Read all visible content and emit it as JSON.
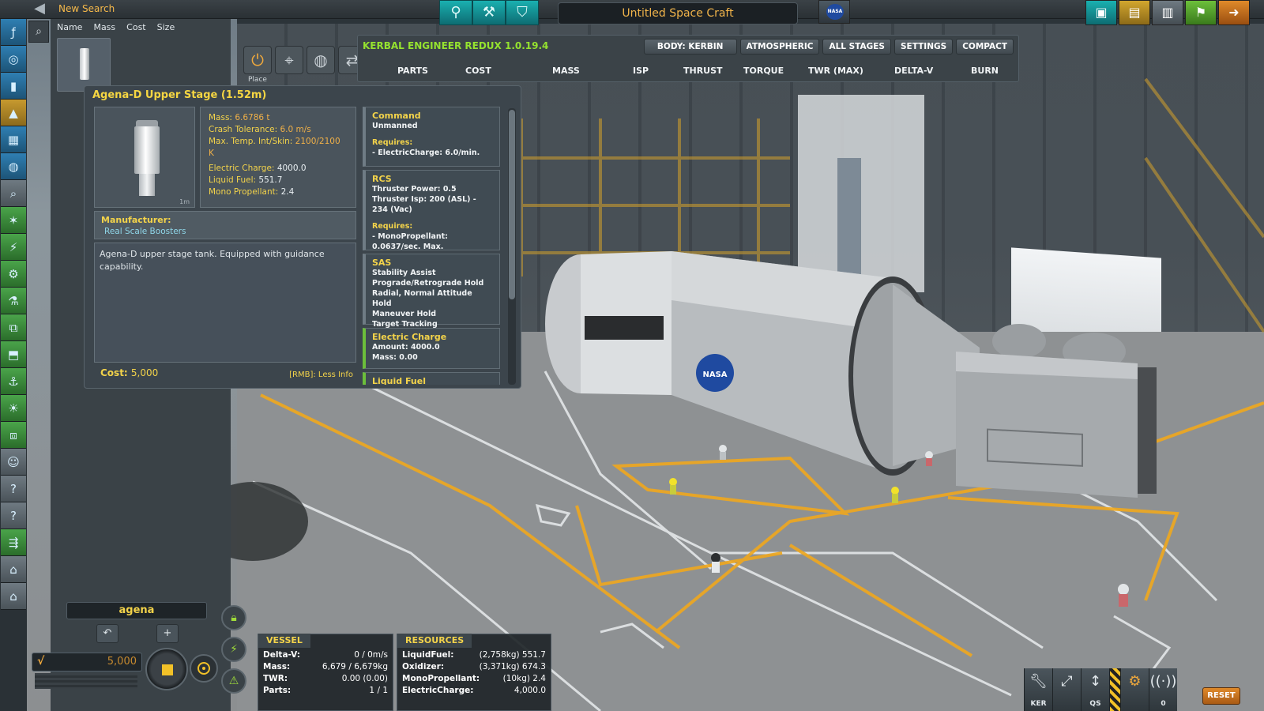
{
  "topbar": {
    "search_title": "New Search",
    "craft_name": "Untitled Space Craft"
  },
  "parts_list": {
    "sort_columns": [
      "Name",
      "Mass",
      "Cost",
      "Size"
    ],
    "search_value": "agena",
    "funds": "5,000"
  },
  "editor_tools": {
    "place_label": "Place"
  },
  "part_info": {
    "title": "Agena-D Upper Stage (1.52m)",
    "scale_label": "1m",
    "stats": {
      "mass_label": "Mass:",
      "mass_value": "6.6786 t",
      "crash_label": "Crash Tolerance:",
      "crash_value": "6.0 m/s",
      "temp_label": "Max. Temp. Int/Skin:",
      "temp_value": "2100/2100 K",
      "electric_label": "Electric Charge:",
      "electric_value": "4000.0",
      "liquid_label": "Liquid Fuel:",
      "liquid_value": "551.7",
      "mono_label": "Mono Propellant:",
      "mono_value": "2.4"
    },
    "manufacturer_label": "Manufacturer:",
    "manufacturer_name": "Real Scale Boosters",
    "description": "Agena-D upper stage tank. Equipped with guidance capability.",
    "cost_label": "Cost:",
    "cost_value": "5,000",
    "rmb_hint": "[RMB]: Less Info",
    "modules": {
      "command": {
        "title": "Command",
        "line1": "Unmanned",
        "req_label": "Requires:",
        "req1": "- ElectricCharge: 6.0/min."
      },
      "rcs": {
        "title": "RCS",
        "line1": "Thruster Power: 0.5",
        "line2": "Thruster Isp: 200 (ASL) - 234 (Vac)",
        "req_label": "Requires:",
        "req1": "- MonoPropellant: 0.0637/sec. Max."
      },
      "sas": {
        "title": "SAS",
        "line1": "Stability Assist",
        "line2": "Prograde/Retrograde Hold",
        "line3": "Radial, Normal Attitude Hold",
        "line4": "Maneuver Hold",
        "line5": "Target Tracking"
      },
      "electric": {
        "title": "Electric Charge",
        "line1": "Amount: 4000.0",
        "line2": "Mass: 0.00"
      },
      "liquid": {
        "title": "Liquid Fuel"
      }
    }
  },
  "ker": {
    "title": "KERBAL ENGINEER REDUX 1.0.19.4",
    "buttons": {
      "body": "BODY: KERBIN",
      "atmospheric": "ATMOSPHERIC",
      "all_stages": "ALL STAGES",
      "settings": "SETTINGS",
      "compact": "COMPACT"
    },
    "columns": {
      "parts": "PARTS",
      "cost": "COST",
      "mass": "MASS",
      "isp": "ISP",
      "thrust": "THRUST",
      "torque": "TORQUE",
      "twr": "TWR (MAX)",
      "deltav": "DELTA-V",
      "burn": "BURN"
    }
  },
  "vessel": {
    "tab": "VESSEL",
    "rows": [
      {
        "label": "Delta-V:",
        "value": "0 / 0m/s"
      },
      {
        "label": "Mass:",
        "value": "6,679 / 6,679kg"
      },
      {
        "label": "TWR:",
        "value": "0.00 (0.00)"
      },
      {
        "label": "Parts:",
        "value": "1 / 1"
      }
    ]
  },
  "resources": {
    "tab": "RESOURCES",
    "rows": [
      {
        "label": "LiquidFuel:",
        "value": "(2,758kg) 551.7"
      },
      {
        "label": "Oxidizer:",
        "value": "(3,371kg) 674.3"
      },
      {
        "label": "MonoPropellant:",
        "value": "(10kg) 2.4"
      },
      {
        "label": "ElectricCharge:",
        "value": "4,000.0"
      }
    ]
  },
  "bottom_toolbar": {
    "ker_label": "KER",
    "qs_label": "QS",
    "comm_count": "0",
    "reset_label": "RESET"
  },
  "scene": {
    "nasa_logo_text": "NASA"
  },
  "colors": {
    "accent_yellow": "#f3d34a",
    "ker_green": "#95e22f",
    "orange_text": "#f0b048",
    "teal_mode": "#1ab0b0"
  }
}
